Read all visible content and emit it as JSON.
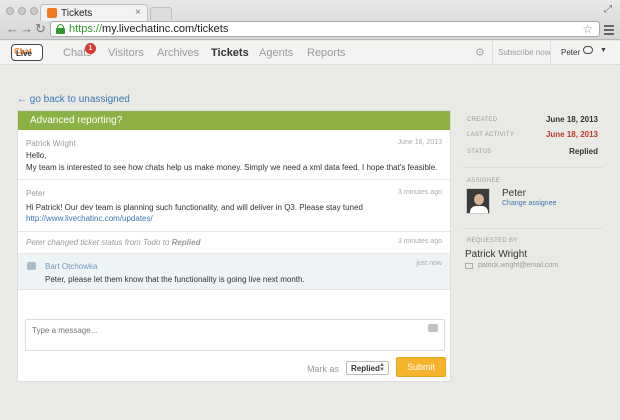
{
  "browser": {
    "tab_title": "Tickets",
    "tab_close": "×",
    "url_https": "https://",
    "url_rest": "my.livechatinc.com/tickets"
  },
  "app": {
    "logo_live": "Live",
    "logo_chat": "Chat",
    "nav": [
      "Chats",
      "Visitors",
      "Archives",
      "Tickets",
      "Agents",
      "Reports"
    ],
    "chats_badge": "1",
    "subscribe": "Subscribe now",
    "user": "Peter"
  },
  "back_link": "← go back to unassigned",
  "ticket": {
    "title": "Advanced reporting?",
    "messages": [
      {
        "author": "Patrick Wright",
        "time": "June 18, 2013",
        "lines": [
          "Hello,",
          "My team is interested to see how chats help us make money. Simply we need a xml data feed. I hope that's feasible."
        ]
      },
      {
        "author": "Peter",
        "time": "3 minutes ago",
        "lines": [
          "Hi Patrick! Our dev team is planning such functionality, and will deliver in Q3. Please stay tuned"
        ],
        "link": "http://www.livechatinc.com/updates/"
      }
    ],
    "system_event": {
      "text": "Peter changed ticket status from Todo to ",
      "status": "Replied",
      "time": "3 minutes ago"
    },
    "agent_message": {
      "author": "Bart Otchowka",
      "time": "just now",
      "text": "Peter, please let them know that the functionality is going live next month."
    },
    "composer_placeholder": "Type a message...",
    "mark_as_label": "Mark as",
    "mark_as_value": "Replied",
    "submit_label": "Submit"
  },
  "sidebar": {
    "created_label": "Created",
    "created_value": "June 18, 2013",
    "last_activity_label": "Last activity",
    "last_activity_value": "June 18, 2013",
    "status_label": "Status",
    "status_value": "Replied",
    "assignee_label": "Assignee",
    "assignee_name": "Peter",
    "change_assignee": "Change assignee",
    "requested_by_label": "Requested by",
    "requester_name": "Patrick Wright",
    "requester_email": "patrick.wright@email.com"
  },
  "colors": {
    "accent_green": "#8db045",
    "submit_orange": "#f6b32b",
    "link_blue": "#3a79b4",
    "alert_red": "#c0392b"
  }
}
